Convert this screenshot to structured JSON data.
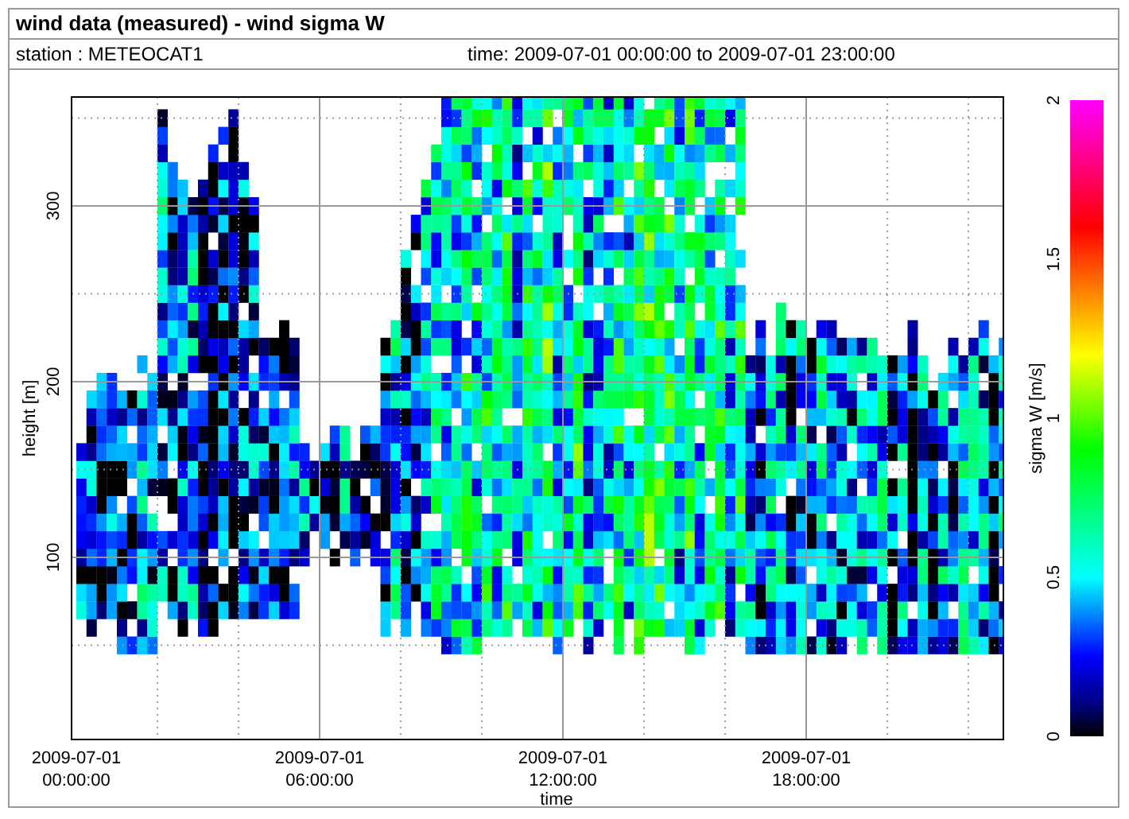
{
  "window": {
    "title": "wind data (measured) - wind sigma W"
  },
  "info": {
    "station": "station : METEOCAT1",
    "time_range": "time: 2009-07-01 00:00:00 to 2009-07-01 23:00:00"
  },
  "plot": {
    "y_label": "height [m]",
    "y_ticks": [
      "100",
      "200",
      "300"
    ],
    "x_ticks": [
      {
        "date": "2009-07-01",
        "time": "00:00:00"
      },
      {
        "date": "2009-07-01",
        "time": "06:00:00"
      },
      {
        "date": "2009-07-01",
        "time": "12:00:00"
      },
      {
        "date": "2009-07-01",
        "time": "18:00:00"
      }
    ],
    "x_label": "time"
  },
  "colorbar": {
    "label": "sigma W [m/s]",
    "ticks": [
      "0",
      "0.5",
      "1",
      "1.5",
      "2"
    ]
  }
}
